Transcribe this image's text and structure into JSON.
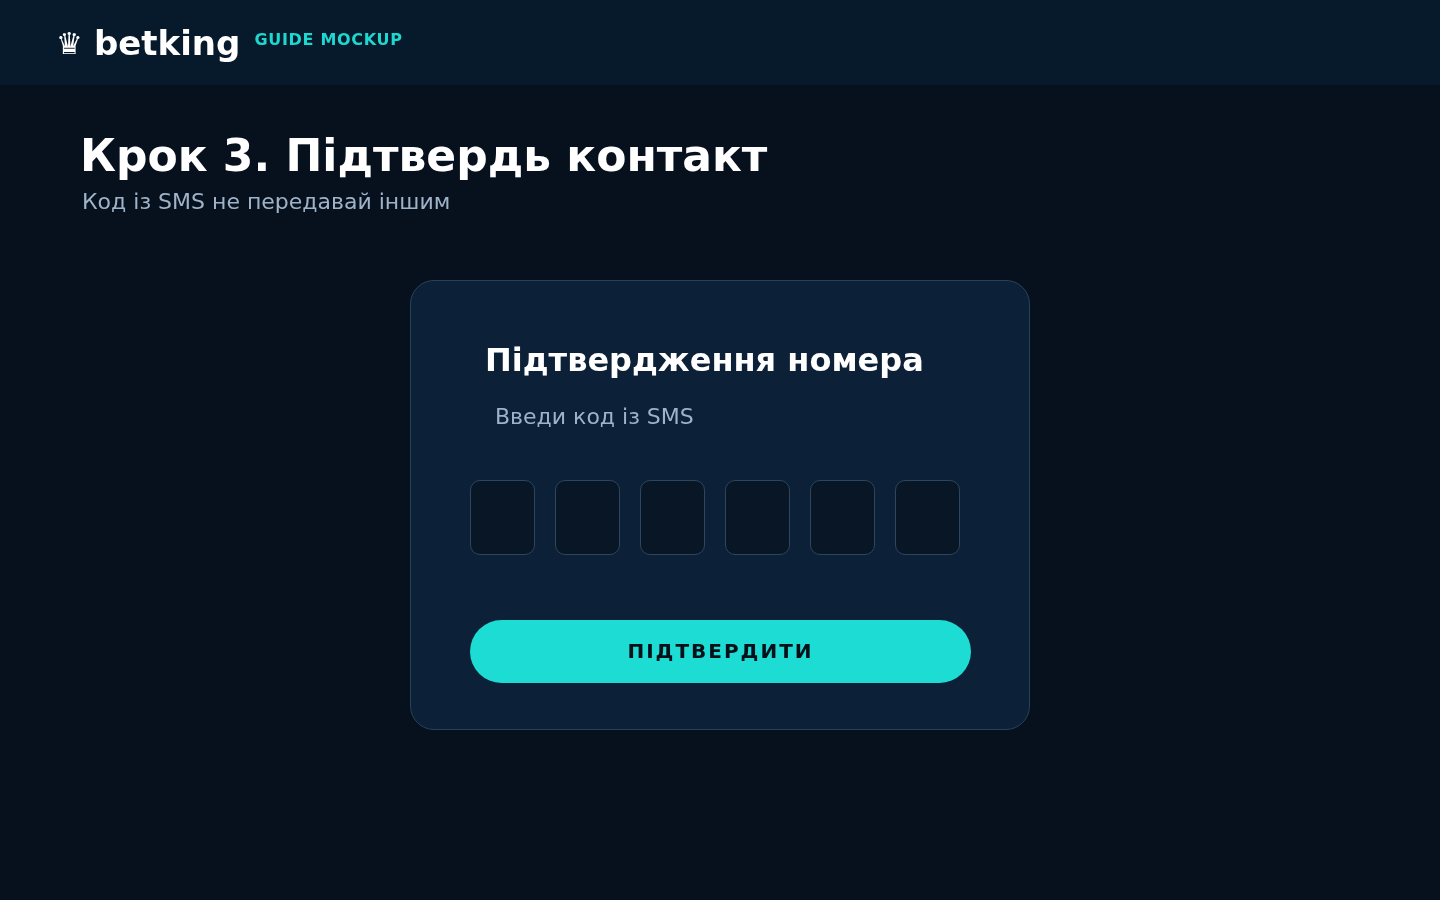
{
  "header": {
    "logo_icon": "♛",
    "logo_text": "betking",
    "badge": "GUIDE MOCKUP"
  },
  "page": {
    "title": "Крок 3. Підтвердь контакт",
    "subtitle": "Код із SMS не передавай іншим"
  },
  "card": {
    "title": "Підтвердження номера",
    "instruction": "Введи код із SMS",
    "code_fields": [
      {
        "kind": "digit"
      },
      {
        "kind": "digit"
      },
      {
        "kind": "digit"
      },
      {
        "kind": "digit"
      },
      {
        "kind": "digit"
      },
      {
        "kind": "digit"
      }
    ],
    "button": "ПІДТВЕРДИТИ"
  }
}
